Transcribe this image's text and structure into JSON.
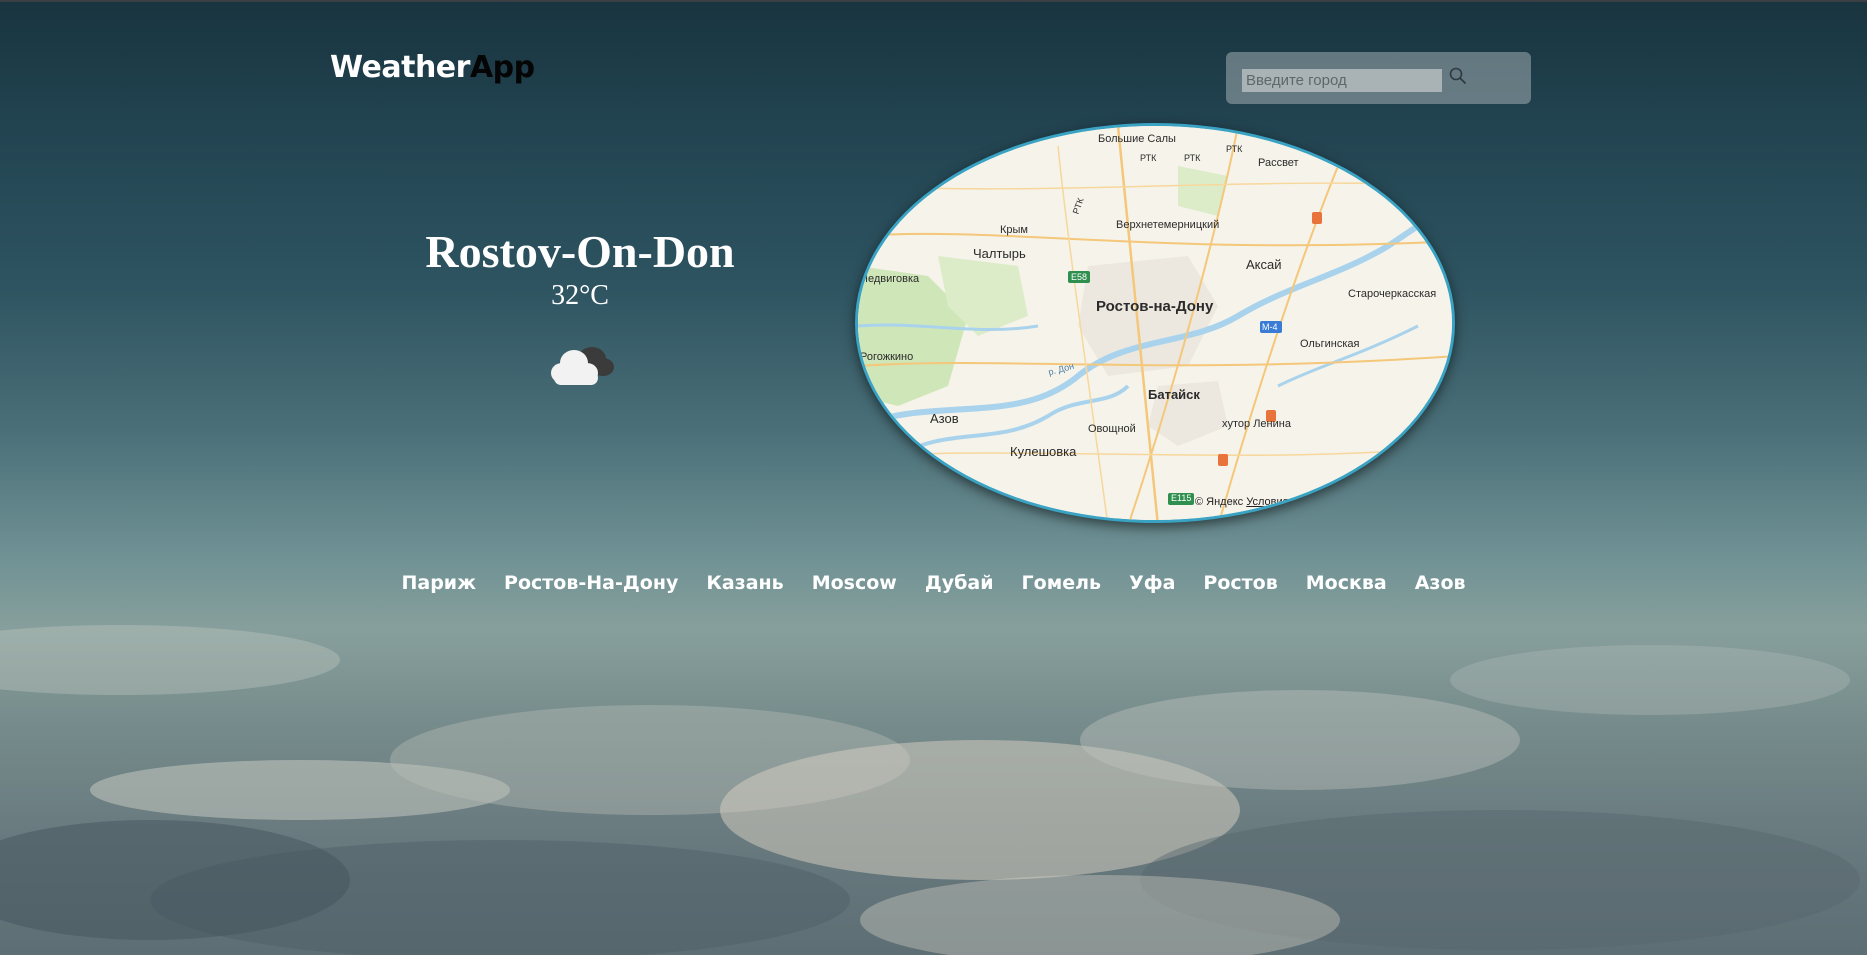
{
  "header": {
    "logo_part1": "Weather",
    "logo_part2": "App"
  },
  "search": {
    "placeholder": "Введите город",
    "value": "",
    "icon": "search-icon"
  },
  "current": {
    "city": "Rostov-On-Don",
    "temperature": "32°C",
    "condition_icon": "cloud-icon"
  },
  "map": {
    "labels": {
      "bolshie_saly": "Большие Салы",
      "rtk1": "РТК",
      "rtk2": "РТК",
      "rtk3": "РТК",
      "rtk4": "РТК",
      "rassvet": "Рассвет",
      "krym": "Крым",
      "chaltyr": "Чалтырь",
      "verkhnetemernitsky": "Верхнетемерницкий",
      "aksay": "Аксай",
      "nedvigovka": "Недвиговка",
      "e58": "E58",
      "rostov": "Ростов-на-Дону",
      "m4": "M-4",
      "starocherkasskaya": "Старочеркасская",
      "olginskaya": "Ольгинская",
      "rogozhkino": "Рогожкино",
      "r_don": "р. Дон",
      "bataysk": "Батайск",
      "azov": "Азов",
      "ovoshchnoy": "Овощной",
      "khutor_lenina": "хутор Ленина",
      "kuleshovka": "Кулешовка",
      "e115": "E115"
    },
    "copyright": "© Яндекс",
    "terms": "Условия"
  },
  "cities": [
    "Париж",
    "Ростов-На-Дону",
    "Казань",
    "Moscow",
    "Дубай",
    "Гомель",
    "Уфа",
    "Ростов",
    "Москва",
    "Азов"
  ],
  "colors": {
    "map_border": "#3aa3c4",
    "logo_dark": "#050505",
    "text": "#ffffff"
  }
}
